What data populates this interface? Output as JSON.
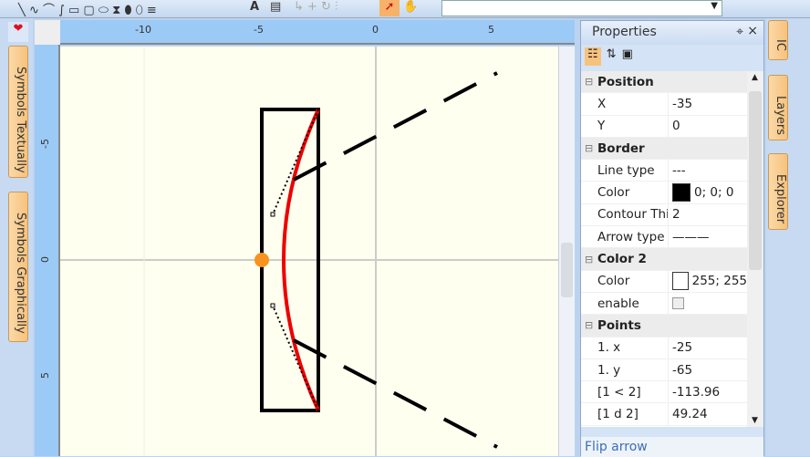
{
  "toolbar": {
    "icons": [
      "line-icon",
      "curve-icon",
      "arc-icon",
      "rect-icon",
      "rounded-rect-icon",
      "ellipse-icon",
      "hourglass-icon",
      "pill-icon",
      "text-icon",
      "note-icon",
      "select-icon",
      "hand-icon"
    ],
    "text_tool": "A"
  },
  "left_tabs": [
    "Symbols Textually",
    "Symbols Graphically"
  ],
  "right_tabs": [
    "IC",
    "Layers",
    "Explorer"
  ],
  "ruler": {
    "x_ticks": [
      "-10",
      "-5",
      "0",
      "5"
    ],
    "y_ticks": [
      "-5",
      "0",
      "5"
    ]
  },
  "properties": {
    "title": "Properties",
    "pin": "⌖",
    "close": "×",
    "categories": [
      {
        "name": "Position",
        "rows": [
          {
            "label": "X",
            "value": "-35"
          },
          {
            "label": "Y",
            "value": "0"
          }
        ]
      },
      {
        "name": "Border",
        "rows": [
          {
            "label": "Line type",
            "value": "---"
          },
          {
            "label": "Color",
            "value": "0; 0; 0",
            "swatch": "#000000"
          },
          {
            "label": "Contour Thi",
            "value": "2"
          },
          {
            "label": "Arrow type",
            "value": "———"
          }
        ]
      },
      {
        "name": "Color 2",
        "rows": [
          {
            "label": "Color",
            "value": "255; 255",
            "swatch": "#ffffff"
          },
          {
            "label": "enable",
            "value": ""
          }
        ]
      },
      {
        "name": "Points",
        "rows": [
          {
            "label": "1. x",
            "value": "-25"
          },
          {
            "label": "1. y",
            "value": "-65"
          },
          {
            "label": "[1 < 2]",
            "value": "-113.96"
          },
          {
            "label": "[1 d 2]",
            "value": "49.24"
          }
        ]
      }
    ],
    "command": "Flip arrow"
  }
}
